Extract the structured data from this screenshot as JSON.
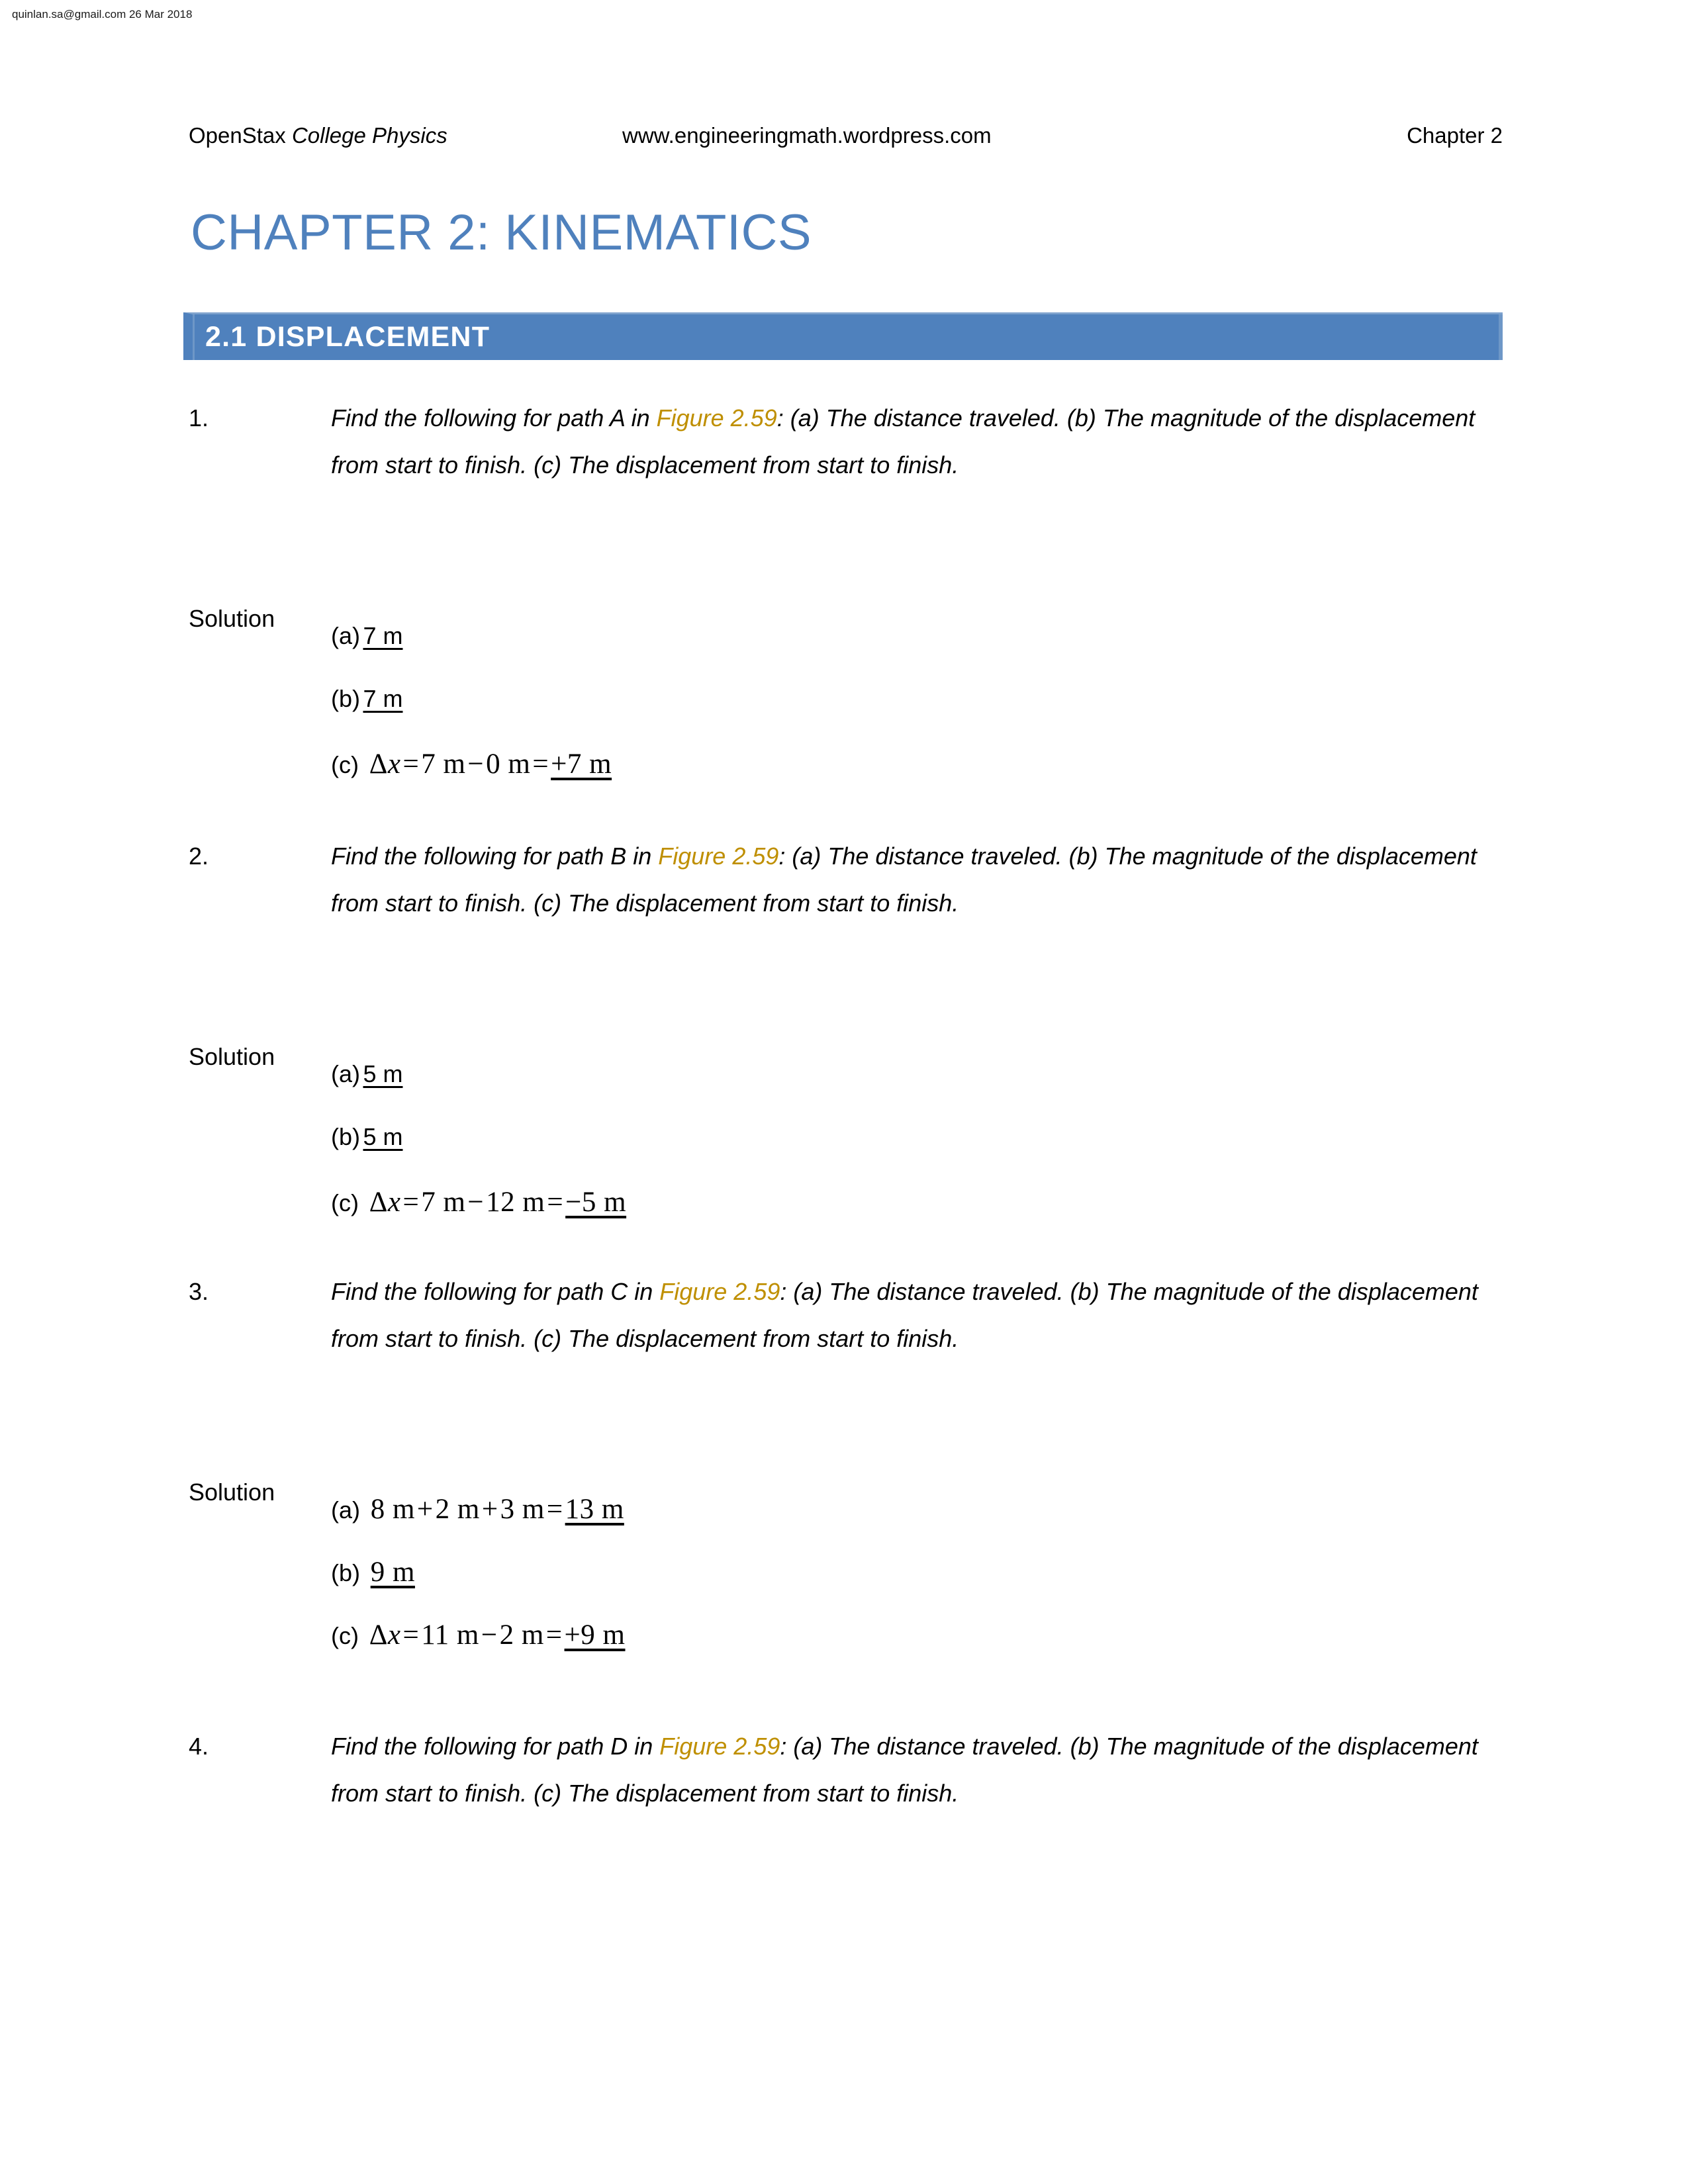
{
  "stamp": "quinlan.sa@gmail.com 26 Mar 2018",
  "running_header": {
    "left_plain": "OpenStax ",
    "left_italic": "College Physics",
    "center": "www.engineeringmath.wordpress.com",
    "right": "Chapter 2"
  },
  "chapter_title": "CHAPTER 2: KINEMATICS",
  "section": {
    "label": "2.1 DISPLACEMENT",
    "bar_color": "#4F81BD",
    "text_color": "#FFFFFF"
  },
  "figure_ref_color": "#BF8F00",
  "solution_label": "Solution",
  "problems": [
    {
      "number": "1.",
      "text_before_ref": "Find the following for path A in ",
      "figure_ref": "Figure 2.59",
      "text_after_ref": ": (a) The distance traveled. (b) The magnitude of the displacement from start to finish. (c) The displacement from start to finish.",
      "answers": [
        {
          "tag": "(a)",
          "style": "plain",
          "value": "7 m",
          "underlined": "7 m"
        },
        {
          "tag": "(b)",
          "style": "plain",
          "value": "7 m",
          "underlined": "7 m"
        },
        {
          "tag": "(c)",
          "style": "math",
          "lhs_symbol": "Δ",
          "lhs_var": "x",
          "eq1": "=",
          "term1": "7 m",
          "op": "−",
          "term2": "0 m",
          "eq2": "=",
          "result": "+7 m"
        }
      ]
    },
    {
      "number": "2.",
      "text_before_ref": "Find the following for path B in ",
      "figure_ref": "Figure 2.59",
      "text_after_ref": ": (a) The distance traveled. (b) The magnitude of the displacement from start to finish. (c) The displacement from start to finish.",
      "answers": [
        {
          "tag": "(a)",
          "style": "plain",
          "value": "5 m",
          "underlined": "5 m"
        },
        {
          "tag": "(b)",
          "style": "plain",
          "value": "5 m",
          "underlined": "5 m"
        },
        {
          "tag": "(c)",
          "style": "math",
          "lhs_symbol": "Δ",
          "lhs_var": "x",
          "eq1": "=",
          "term1": "7 m",
          "op": "−",
          "term2": "12 m",
          "eq2": "=",
          "result": "−5 m"
        }
      ]
    },
    {
      "number": "3.",
      "text_before_ref": "Find the following for path C in ",
      "figure_ref": "Figure 2.59",
      "text_after_ref": ": (a) The distance traveled. (b) The magnitude of the displacement from start to finish. (c) The displacement from start to finish.",
      "answers": [
        {
          "tag": "(a)",
          "style": "math-sum",
          "term1": "8 m",
          "op1": "+",
          "term2": "2 m",
          "op2": "+",
          "term3": "3 m",
          "eq": "=",
          "result": "13 m"
        },
        {
          "tag": "(b)",
          "style": "math-plain",
          "result": "9 m"
        },
        {
          "tag": "(c)",
          "style": "math",
          "lhs_symbol": "Δ",
          "lhs_var": "x",
          "eq1": "=",
          "term1": "11 m",
          "op": "−",
          "term2": "2 m",
          "eq2": "=",
          "result": "+9 m"
        }
      ]
    },
    {
      "number": "4.",
      "text_before_ref": "Find the following for path D in ",
      "figure_ref": "Figure 2.59",
      "text_after_ref": ": (a) The distance traveled. (b) The magnitude of the displacement from start to finish. (c) The displacement from start to finish.",
      "answers": []
    }
  ]
}
